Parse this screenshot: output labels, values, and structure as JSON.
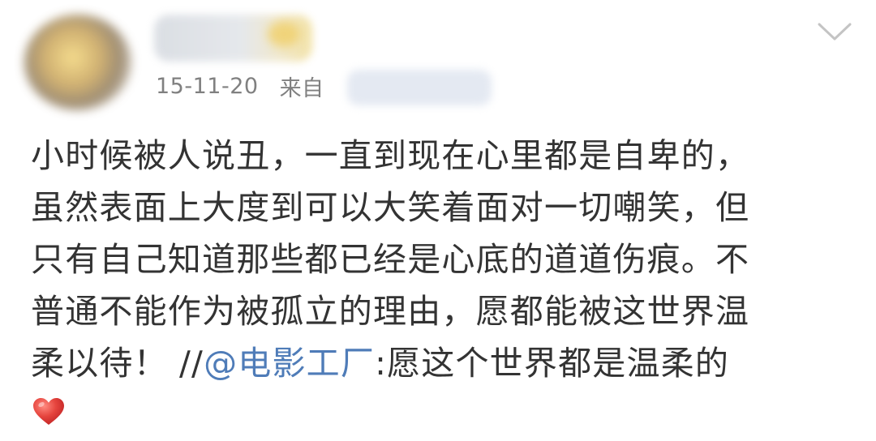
{
  "post": {
    "date": "15-11-20",
    "source_prefix": "来自",
    "lines": {
      "l1": "小时候被人说丑，一直到现在心里都是自卑的，",
      "l2": "虽然表面上大度到可以大笑着面对一切嘲笑，但",
      "l3": "只有自己知道那些都已经是心底的道道伤痕。不",
      "l4": "普通不能作为被孤立的理由，愿都能被这世界温",
      "l5_before": "柔以待！ //",
      "l5_mention": "@电影工厂",
      "l5_after": ":愿这个世界都是温柔的"
    },
    "emoji": "heart-emoji"
  },
  "colors": {
    "text": "#333333",
    "meta": "#808080",
    "mention": "#4f7cb8",
    "heart": "#e6453e"
  }
}
